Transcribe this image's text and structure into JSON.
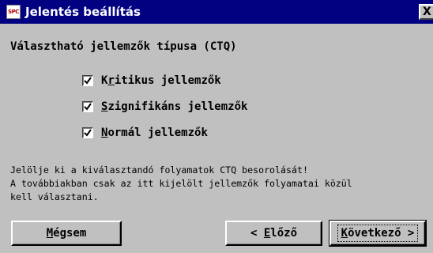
{
  "window": {
    "title": "Jelentés beállítás",
    "icon_text": "SPC",
    "close_glyph": "X"
  },
  "heading": "Választható jellemzők típusa (CTQ)",
  "checkboxes": [
    {
      "mnemonic": "K",
      "rest_a": "r",
      "u": "i",
      "rest_b": "tikus jellemzők",
      "checked": true
    },
    {
      "mnemonic": "S",
      "rest_a": "",
      "u": "z",
      "rest_b": "ignifikáns jellemzők",
      "checked": true
    },
    {
      "mnemonic": "N",
      "rest_a": "",
      "u": "",
      "rest_b": "ormál jellemzők",
      "checked": true
    }
  ],
  "labels": {
    "cb0": {
      "pre": "K",
      "u": "r",
      "post": "itikus jellemzők"
    },
    "cb1": {
      "pre": "",
      "u": "S",
      "post": "zignifikáns jellemzők"
    },
    "cb2": {
      "pre": "",
      "u": "N",
      "post": "ormál jellemzők"
    }
  },
  "info_lines": [
    "Jelölje ki a kiválasztandó folyamatok CTQ besorolását!",
    "A továbbiakban csak az itt kijelölt jellemzők folyamatai közül",
    "kell választani."
  ],
  "buttons": {
    "cancel": {
      "u": "M",
      "post": "égsem"
    },
    "prev": {
      "pre": "< ",
      "u": "E",
      "post": "lőző"
    },
    "next": {
      "u": "K",
      "post": "övetkező >"
    }
  }
}
